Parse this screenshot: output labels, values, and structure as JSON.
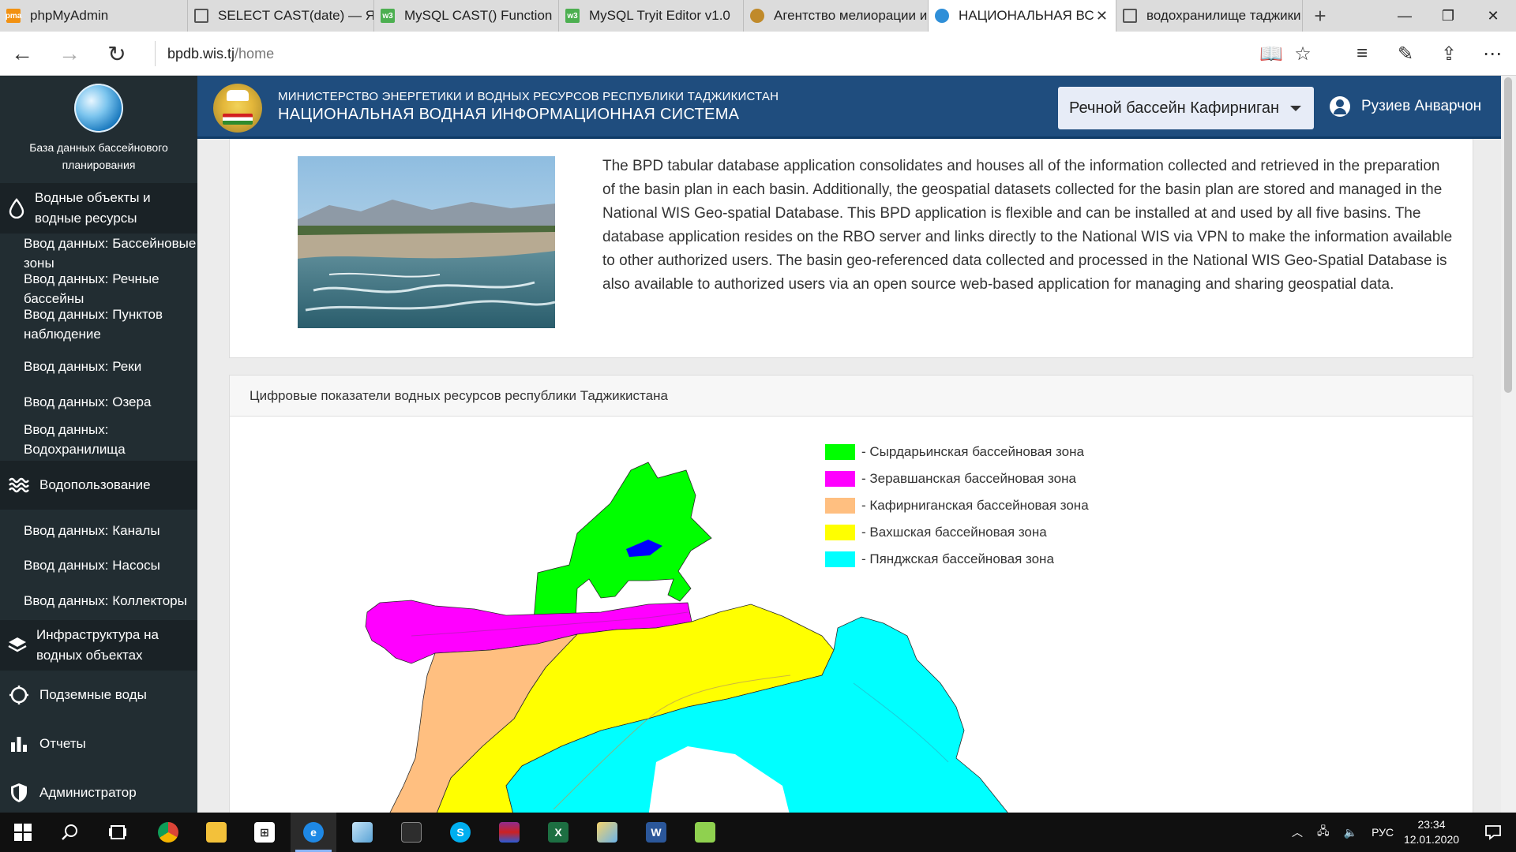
{
  "browser": {
    "tabs": [
      {
        "label": "phpMyAdmin",
        "icon": "phpmyadmin-icon",
        "color": "#f29111"
      },
      {
        "label": "SELECT CAST(date) — Ян",
        "icon": "page-icon",
        "color": "#555555"
      },
      {
        "label": "MySQL CAST() Function",
        "icon": "w3schools-icon",
        "color": "#4caf50"
      },
      {
        "label": "MySQL Tryit Editor v1.0",
        "icon": "w3schools-icon",
        "color": "#4caf50"
      },
      {
        "label": "Агентство мелиорации и",
        "icon": "site-icon",
        "color": "#c08a2a"
      },
      {
        "label": "НАЦИОНАЛЬНАЯ ВС",
        "icon": "water-drop-icon",
        "color": "#2f8fd8"
      },
      {
        "label": "водохранилище таджики",
        "icon": "page-icon",
        "color": "#555555"
      }
    ],
    "url_host": "bpdb.wis.tj",
    "url_path": "/home"
  },
  "sidebar": {
    "title": "База данных бассейнового планирования",
    "sections": [
      {
        "label": "Водные объекты и водные ресурсы",
        "icon": "water-drop-icon",
        "items": [
          "Ввод данных: Бассейновые зоны",
          "Ввод данных: Речные бассейны",
          "Ввод данных: Пунктов наблюдение",
          "Ввод данных: Реки",
          "Ввод данных: Озера",
          "Ввод данных: Водохранилища"
        ]
      },
      {
        "label": "Водопользование",
        "icon": "waves-icon",
        "items": [
          "Ввод данных: Каналы",
          "Ввод данных: Насосы",
          "Ввод данных: Коллекторы"
        ]
      },
      {
        "label": "Инфраструктура на водных объектах",
        "icon": "layers-icon",
        "items": []
      },
      {
        "label": "Подземные воды",
        "icon": "circle-icon",
        "items": []
      },
      {
        "label": "Отчеты",
        "icon": "bar-chart-icon",
        "items": []
      },
      {
        "label": "Администратор",
        "icon": "shield-icon",
        "items": []
      }
    ]
  },
  "header": {
    "ministry": "МИНИСТЕРСТВО ЭНЕРГЕТИКИ И ВОДНЫХ РЕСУРСОВ РЕСПУБЛИКИ ТАДЖИКИСТАН",
    "system": "НАЦИОНАЛЬНАЯ ВОДНАЯ ИНФОРМАЦИОННАЯ СИСТЕМА",
    "basin_selected": "Речной бассейн Кафирниган",
    "user_name": "Рузиев Анварчон"
  },
  "intro": {
    "text": "The BPD tabular database application consolidates and houses all of the information collected and retrieved in the preparation of the basin plan in each basin. Additionally, the geospatial datasets collected for the basin plan are stored and managed in the National WIS Geo-spatial Database. This BPD application is flexible and can be installed at and used by all five basins. The database application resides on the RBO server and links directly to the National WIS via VPN to make the information available to other authorized users. The basin geo-referenced data collected and processed in the National WIS Geo-Spatial Database is also available to authorized users via an open source web-based application for managing and sharing geospatial data."
  },
  "map_card": {
    "title": "Цифровые показатели водных ресурсов республики Таджикистана",
    "legend": [
      {
        "label": "- Сырдарьинская бассейновая зона",
        "color": "#00ff00"
      },
      {
        "label": "- Зеравшанская бассейновая зона",
        "color": "#ff00ff"
      },
      {
        "label": "- Кафирниганская бассейновая зона",
        "color": "#ffbf80"
      },
      {
        "label": "- Вахшская бассейновая зона",
        "color": "#ffff00"
      },
      {
        "label": "- Пянджская бассейновая зона",
        "color": "#00ffff"
      }
    ]
  },
  "taskbar": {
    "lang": "РУС",
    "time": "23:34",
    "date": "12.01.2020"
  }
}
